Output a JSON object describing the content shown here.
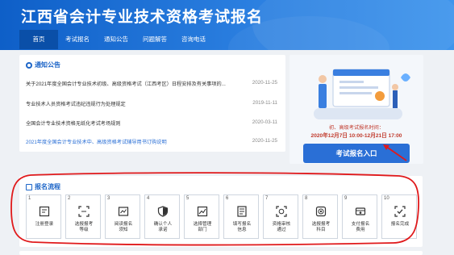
{
  "header": {
    "site_title": "江西省会计专业技术资格考试报名"
  },
  "nav": [
    {
      "label": "首页",
      "active": true
    },
    {
      "label": "考试报名",
      "active": false
    },
    {
      "label": "通知公告",
      "active": false
    },
    {
      "label": "问题解答",
      "active": false
    },
    {
      "label": "咨询电话",
      "active": false
    }
  ],
  "notices": {
    "title": "通知公告",
    "items": [
      {
        "text": "关于2021年度全国会计专业技术初级、高级资格考试（江西考区）日程安排及有关事项的...",
        "date": "2020-11-25",
        "highlight": false
      },
      {
        "text": "专业技术人员资格考试违纪违规行为处理规定",
        "date": "2019-11-11",
        "highlight": false
      },
      {
        "text": "全国会计专业技术资格无纸化考试考场规则",
        "date": "2020-03-11",
        "highlight": false
      },
      {
        "text": "2021年度全国会计专业技术中、高级资格考试辅导用书订购说明",
        "date": "2020-11-25",
        "highlight": true
      }
    ]
  },
  "registration": {
    "line1": "初、高级考试报名时间：",
    "line2": "2020年12月7日 10:00-12月21日 17:00",
    "button_label": "考试报名入口"
  },
  "flow": {
    "title": "报名流程",
    "steps": [
      {
        "num": "1",
        "label": "注册登录",
        "icon": "register-icon"
      },
      {
        "num": "2",
        "label": "选报报考\n等级",
        "icon": "scan-icon"
      },
      {
        "num": "3",
        "label": "阅读报名\n须知",
        "icon": "read-icon"
      },
      {
        "num": "4",
        "label": "确认个人\n承诺",
        "icon": "shield-icon"
      },
      {
        "num": "5",
        "label": "选择管理\n部门",
        "icon": "chart-icon"
      },
      {
        "num": "6",
        "label": "填写报名\n信息",
        "icon": "form-icon"
      },
      {
        "num": "7",
        "label": "资格审核\n通过",
        "icon": "face-scan-icon"
      },
      {
        "num": "8",
        "label": "选报报考\n科目",
        "icon": "target-icon"
      },
      {
        "num": "9",
        "label": "支付报名\n费用",
        "icon": "payment-icon"
      },
      {
        "num": "10",
        "label": "报名完成",
        "icon": "check-icon"
      }
    ]
  },
  "colors": {
    "header_blue": "#1e6fd9",
    "accent_blue": "#2a6fd6",
    "notice_red": "#c0392b",
    "annotation_red": "#e0191b"
  }
}
